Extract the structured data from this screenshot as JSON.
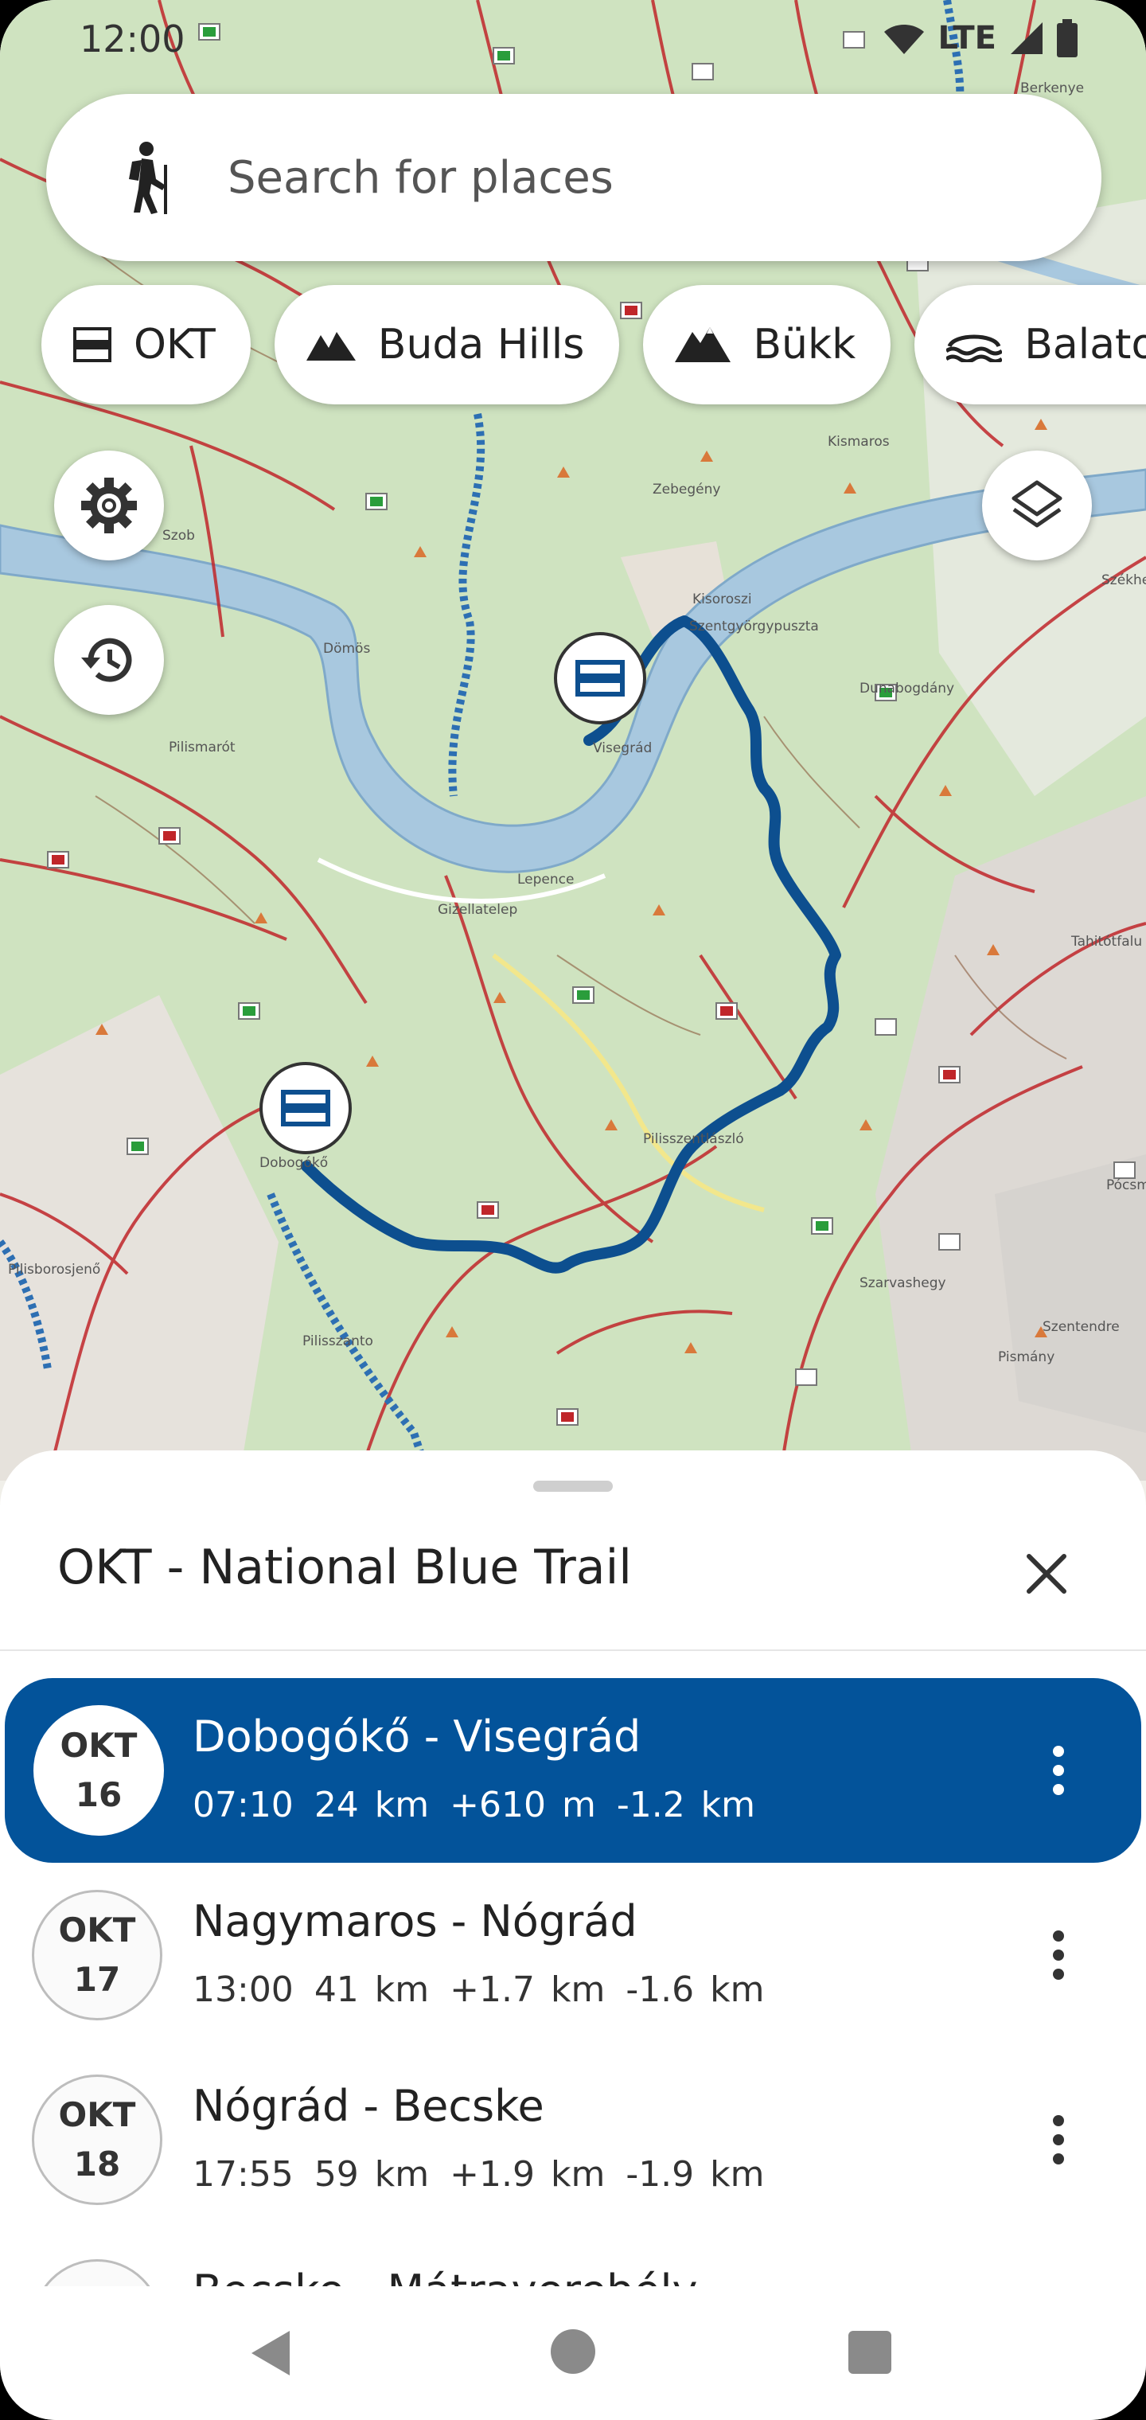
{
  "status_bar": {
    "time": "12:00",
    "network": "LTE"
  },
  "search": {
    "placeholder": "Search for places",
    "icon": "hiker-icon"
  },
  "chips": [
    {
      "label": "OKT",
      "icon": "okt-trail-icon"
    },
    {
      "label": "Buda Hills",
      "icon": "mountain-icon"
    },
    {
      "label": "Bükk",
      "icon": "mountain-icon"
    },
    {
      "label": "Balaton",
      "icon": "lake-icon"
    }
  ],
  "map": {
    "route_color": "#0d4f8f",
    "place_labels": [
      "Visegrád",
      "Kisoroszi",
      "Lepence",
      "Gizellatelep",
      "Pilisszentlászló",
      "Dobogókő",
      "Szentgyörgypuszta",
      "Tahitótfalu",
      "Szarvashegy",
      "Pismány",
      "Szentendre",
      "Pilisszanto",
      "Pilismarót",
      "Dömös",
      "Szob",
      "Zebegény",
      "Berkenye",
      "Kismaros",
      "Székhegy",
      "Pócsmegyer",
      "Dunabogdány",
      "Pilisborosjenő"
    ]
  },
  "sheet": {
    "title": "OKT - National Blue Trail",
    "items": [
      {
        "badge_line1": "OKT",
        "badge_line2": "16",
        "title": "Dobogókő - Visegrád",
        "time": "07:10",
        "distance": "24 km",
        "ascent": "+610 m",
        "descent": "-1.2 km",
        "selected": true
      },
      {
        "badge_line1": "OKT",
        "badge_line2": "17",
        "title": "Nagymaros - Nógrád",
        "time": "13:00",
        "distance": "41 km",
        "ascent": "+1.7 km",
        "descent": "-1.6 km",
        "selected": false
      },
      {
        "badge_line1": "OKT",
        "badge_line2": "18",
        "title": "Nógrád - Becske",
        "time": "17:55",
        "distance": "59 km",
        "ascent": "+1.9 km",
        "descent": "-1.9 km",
        "selected": false
      }
    ],
    "peek_title": "Becske - Mátraverebély"
  }
}
